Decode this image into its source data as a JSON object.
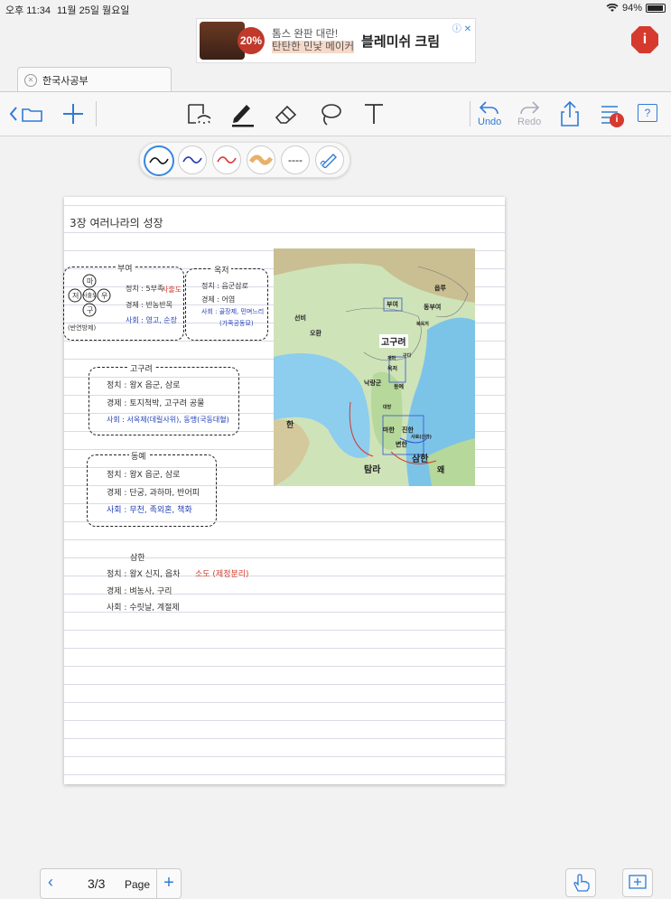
{
  "status": {
    "time": "오후 11:34",
    "date": "11월 25일 월요일",
    "battery": "94%"
  },
  "ad": {
    "badge": "20%",
    "line1": "톰스 완판 대란!",
    "line2": "탄탄한 민낯 메이커",
    "brand": "블레미쉬 크림",
    "ad_marks": "ⓘ ✕"
  },
  "info_button": {
    "label": "i"
  },
  "tab": {
    "title": "한국사공부"
  },
  "toolbar": {
    "undo": "Undo",
    "redo": "Redo",
    "notif_badge": "i",
    "help": "?"
  },
  "pens": {
    "dashed_label": "----"
  },
  "note": {
    "title": "3장 여러나라의 성장",
    "buyeo": {
      "heading": "부여",
      "ga": "마",
      "ga2": "저",
      "ga3": "구",
      "ga4": "우",
      "center": "사출도",
      "caption": "(반연방제)",
      "l1": "정치 : 5부족",
      "l1b": "사출도",
      "l2": "경제 : 반농반목",
      "l3": "사회 : 영고, 순장"
    },
    "okjeo": {
      "heading": "옥저",
      "l1": "정치 : 읍군삼로",
      "l2": "경제 : 어염",
      "l3": "사회 : 골장제, 민며느리",
      "l3b": "(가족공동묘)"
    },
    "goguryeo": {
      "heading": "고구려",
      "l1": "정치 : 왕X 읍군, 삼로",
      "l2": "경제 : 토지척박, 고구려 공물",
      "l3": "사회 : 서옥제(데릴사위), 동맹(국동대혈)"
    },
    "dongye": {
      "heading": "동예",
      "l1": "정치 : 왕X 읍군, 삼로",
      "l2": "경제 : 단궁, 과하마, 반어피",
      "l3": "사회 : 무천, 족외혼, 책화"
    },
    "samhan": {
      "heading": "삼한",
      "l1": "정치 : 왕X 신지, 읍차",
      "l1b": "소도 (제정분리)",
      "l2": "경제 : 벼농사, 구리",
      "l3": "사회 : 수릿날, 계절제"
    },
    "map_labels": {
      "buyeo": "부여",
      "eupru": "읍루",
      "dongbuyeo": "동부여",
      "seonbi": "선비",
      "ohwan": "오환",
      "goguryeo": "고구려",
      "okjeo": "옥저",
      "dongye": "동예",
      "nakrang": "낙랑군",
      "han": "한",
      "mahan": "마한",
      "jinhan": "진한",
      "byeonhan": "변한",
      "bohae": "북옥저",
      "gu": "구다",
      "gaema": "개마",
      "daebang": "대방",
      "hanmark": "삼한",
      "jeju": "탐라",
      "saro": "사로(신라)",
      "wa": "왜"
    }
  },
  "pager": {
    "current": "3/3",
    "label": "Page",
    "add": "+"
  }
}
